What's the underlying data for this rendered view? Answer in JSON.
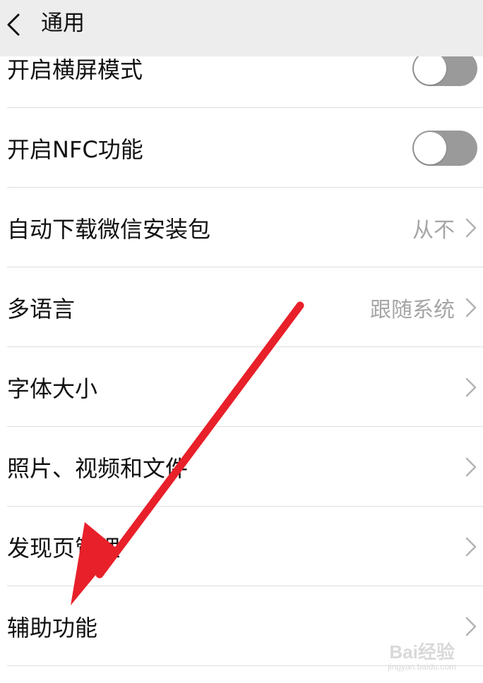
{
  "header": {
    "title": "通用"
  },
  "settings": {
    "landscape": {
      "label": "开启横屏模式",
      "enabled": false
    },
    "nfc": {
      "label": "开启NFC功能",
      "enabled": false
    },
    "auto_download": {
      "label": "自动下载微信安装包",
      "value": "从不"
    },
    "language": {
      "label": "多语言",
      "value": "跟随系统"
    },
    "font_size": {
      "label": "字体大小"
    },
    "media": {
      "label": "照片、视频和文件"
    },
    "discover": {
      "label": "发现页管理"
    },
    "accessibility": {
      "label": "辅助功能"
    }
  },
  "annotation": {
    "arrow_color": "#e8202a"
  },
  "watermark": {
    "main": "Bai经验",
    "sub": "jingyan.baidu.com"
  },
  "colors": {
    "header_bg": "#ededed",
    "toggle_off": "#9a9a9a",
    "secondary_text": "#a6a6a6"
  }
}
